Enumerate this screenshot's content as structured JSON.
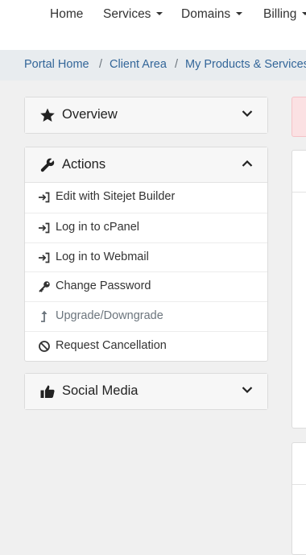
{
  "nav": {
    "items": [
      {
        "label": "Home",
        "dropdown": false
      },
      {
        "label": "Services",
        "dropdown": true
      },
      {
        "label": "Domains",
        "dropdown": true
      },
      {
        "label": "Billing",
        "dropdown": true
      }
    ]
  },
  "breadcrumb": {
    "items": [
      "Portal Home",
      "Client Area",
      "My Products & Services"
    ],
    "separator": "/"
  },
  "sidebar": {
    "overview": {
      "title": "Overview",
      "icon": "star-icon",
      "expanded": false
    },
    "actions": {
      "title": "Actions",
      "icon": "wrench-icon",
      "expanded": true,
      "items": [
        {
          "label": "Edit with Sitejet Builder",
          "icon": "sign-in-icon",
          "disabled": false
        },
        {
          "label": "Log in to cPanel",
          "icon": "sign-in-icon",
          "disabled": false
        },
        {
          "label": "Log in to Webmail",
          "icon": "sign-in-icon",
          "disabled": false
        },
        {
          "label": "Change Password",
          "icon": "key-icon",
          "disabled": false
        },
        {
          "label": "Upgrade/Downgrade",
          "icon": "level-up-icon",
          "disabled": true
        },
        {
          "label": "Request Cancellation",
          "icon": "ban-icon",
          "disabled": false
        }
      ]
    },
    "social": {
      "title": "Social Media",
      "icon": "thumbs-up-icon",
      "expanded": false
    }
  },
  "colors": {
    "link": "#336699",
    "breadcrumb_bg": "#e8ecef",
    "page_bg": "#f0f0f0",
    "alert_bg": "#fbe1e3"
  }
}
